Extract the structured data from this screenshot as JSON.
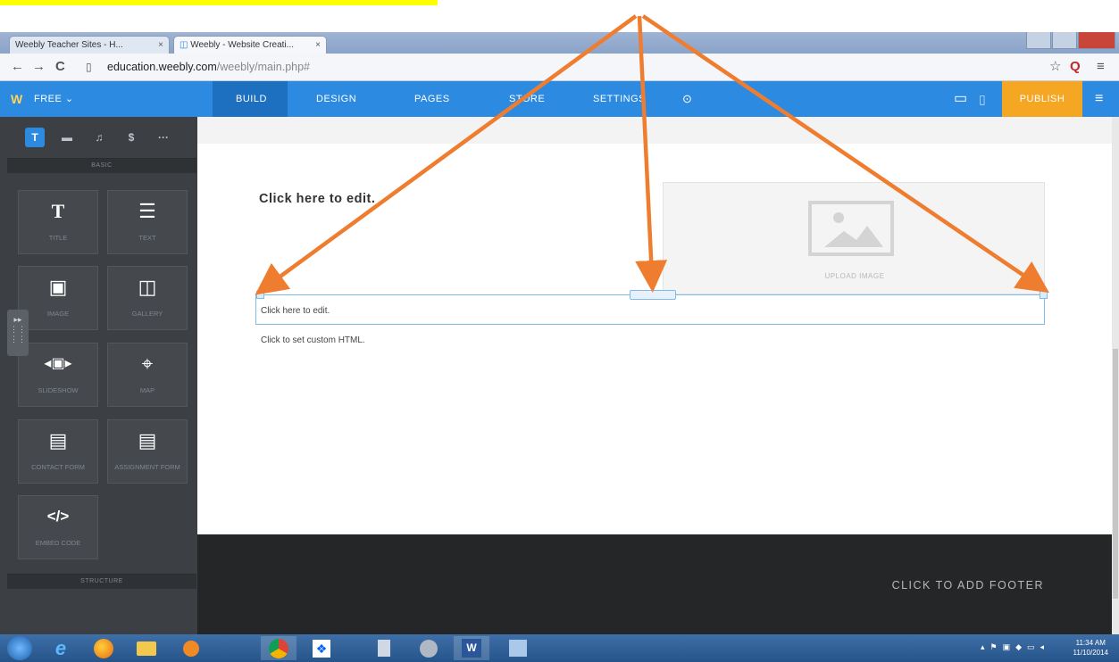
{
  "browser": {
    "tabs": [
      {
        "label": "Weebly Teacher Sites - H..."
      },
      {
        "label": "Weebly - Website Creati..."
      }
    ],
    "url_host": "education.weebly.com",
    "url_path": "/weebly/main.php#"
  },
  "toolbar": {
    "plan_label": "FREE ⌄",
    "tabs": [
      {
        "label": "BUILD"
      },
      {
        "label": "DESIGN"
      },
      {
        "label": "PAGES"
      },
      {
        "label": "STORE"
      },
      {
        "label": "SETTINGS"
      }
    ],
    "publish_label": "PUBLISH",
    "accent_color": "#2c8ae0",
    "publish_color": "#f5a623"
  },
  "sidebar": {
    "top_icons": [
      "T",
      "▬",
      "♫",
      "$",
      "···"
    ],
    "basic_header": "BASIC",
    "structure_header": "STRUCTURE",
    "elements": [
      {
        "icon": "T",
        "label": "TITLE"
      },
      {
        "icon": "☰",
        "label": "TEXT"
      },
      {
        "icon": "▣",
        "label": "IMAGE"
      },
      {
        "icon": "◫",
        "label": "GALLERY"
      },
      {
        "icon": "◂▣▸",
        "label": "SLIDESHOW"
      },
      {
        "icon": "⌖",
        "label": "MAP"
      },
      {
        "icon": "▤",
        "label": "CONTACT FORM"
      },
      {
        "icon": "▤",
        "label": "ASSIGNMENT FORM"
      },
      {
        "icon": "</>",
        "label": "EMBED CODE"
      }
    ]
  },
  "content": {
    "heading": "Click here to edit.",
    "upload_label": "UPLOAD IMAGE",
    "text_block": "Click here to edit.",
    "html_block": "Click to set custom HTML.",
    "footer_label": "CLICK TO ADD FOOTER"
  },
  "taskbar": {
    "time": "11:34 AM",
    "date": "11/10/2014"
  },
  "annotation": {
    "arrow_color": "#ef7d2f",
    "highlight_color": "#ffff00"
  }
}
